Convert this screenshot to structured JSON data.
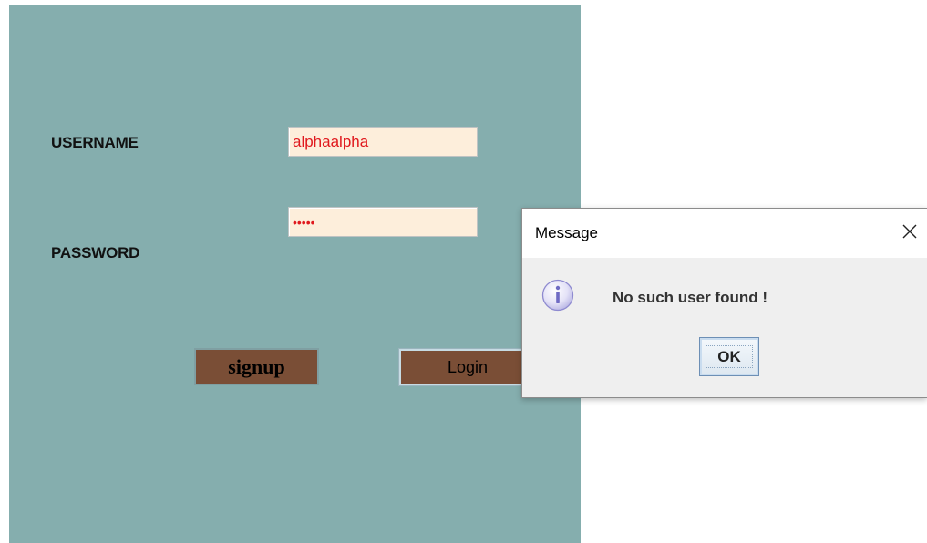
{
  "login_form": {
    "username_label": "USERNAME",
    "password_label": "PASSWORD",
    "username_value": "alphaalpha",
    "password_value": "•••••",
    "signup_label": "signup",
    "login_label": "Login",
    "colors": {
      "panel_background": "#85aeae",
      "input_background": "#fdeedb",
      "input_text": "#e0181d",
      "button_background": "#7a4e36"
    }
  },
  "dialog": {
    "title": "Message",
    "message": "No such user found !",
    "ok_label": "OK",
    "icon": "info-icon",
    "close_icon": "close-icon"
  }
}
